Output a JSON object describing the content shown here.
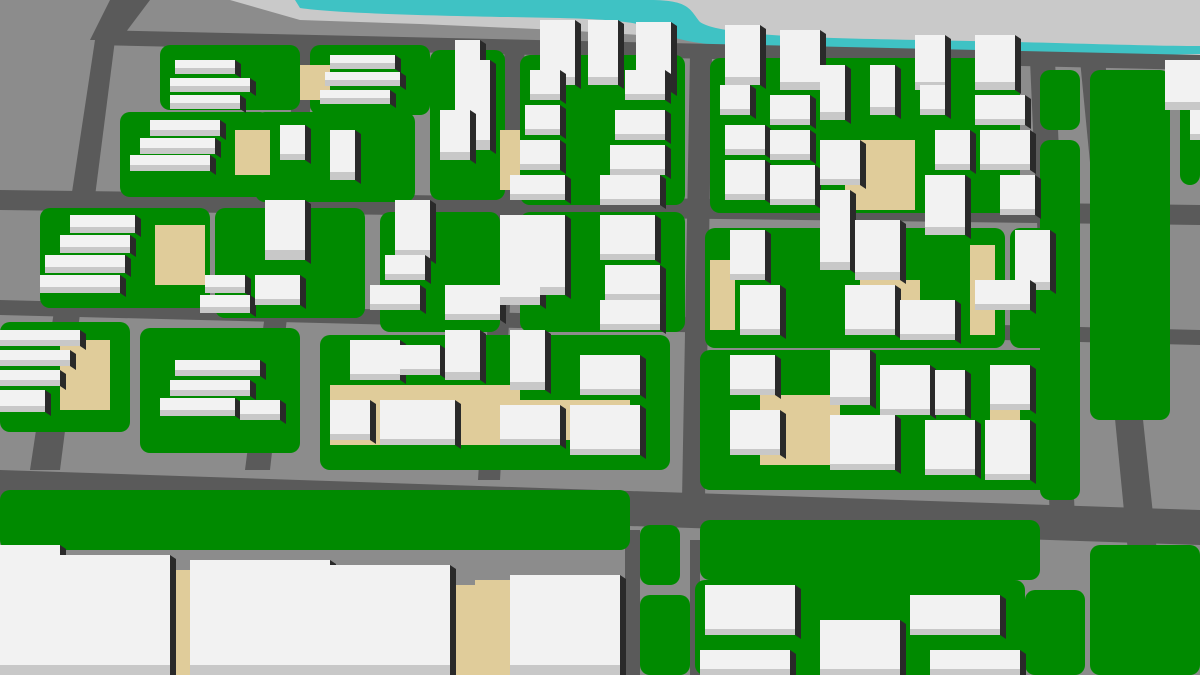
{
  "scene": {
    "subject": "3d-urban-planning-massing-model",
    "colors": {
      "ground": "#8c8c8c",
      "road": "#5a5a5a",
      "curb": "#6e6e6e",
      "green": "#008a00",
      "plaza": "#e0cc9a",
      "water": "#3fc2c4",
      "bank": "#c9c9c9",
      "building_top": "#f2f2f2",
      "building_side": "#c8c8c8",
      "building_shadow": "#2a2a2a"
    }
  }
}
